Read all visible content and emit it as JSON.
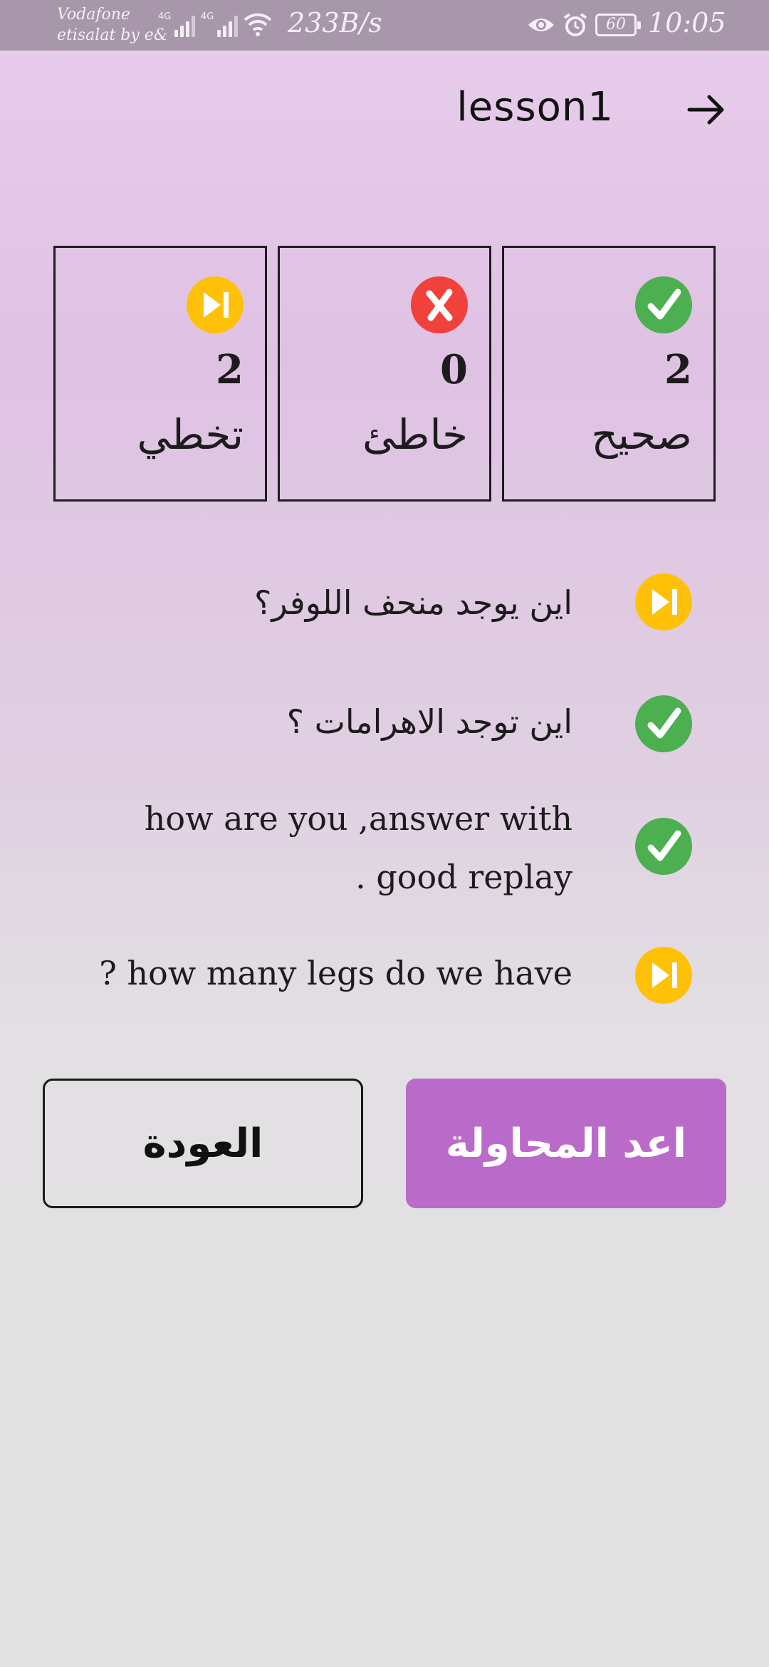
{
  "status_bar": {
    "carrier_line1": "Vodafone",
    "carrier_line2": "etisalat by e&",
    "net1": "4G",
    "net2": "4G",
    "speed": "233B/s",
    "battery": "60",
    "time": "10:05"
  },
  "header": {
    "title": "lesson1"
  },
  "stats": [
    {
      "label": "صحيح",
      "value": "2",
      "icon": "check-icon",
      "color": "#4caf50"
    },
    {
      "label": "خاطئ",
      "value": "0",
      "icon": "cross-icon",
      "color": "#f0413a"
    },
    {
      "label": "تخطي",
      "value": "2",
      "icon": "skip-icon",
      "color": "#ffc107"
    }
  ],
  "questions": [
    {
      "text": "اين يوجد منحف اللوفر؟",
      "status": "skip-icon"
    },
    {
      "text": "اين توجد الاهرامات ؟",
      "status": "check-icon"
    },
    {
      "text": "how are you ,answer with good replay .",
      "status": "check-icon"
    },
    {
      "text": "how many legs do we have ?",
      "status": "skip-icon"
    }
  ],
  "buttons": {
    "back_label": "العودة",
    "retry_label": "اعد المحاولة"
  },
  "colors": {
    "accent": "#ba6bc9",
    "correct": "#4caf50",
    "wrong": "#f0413a",
    "skip": "#ffc107",
    "status_bar": "#a896ab"
  }
}
